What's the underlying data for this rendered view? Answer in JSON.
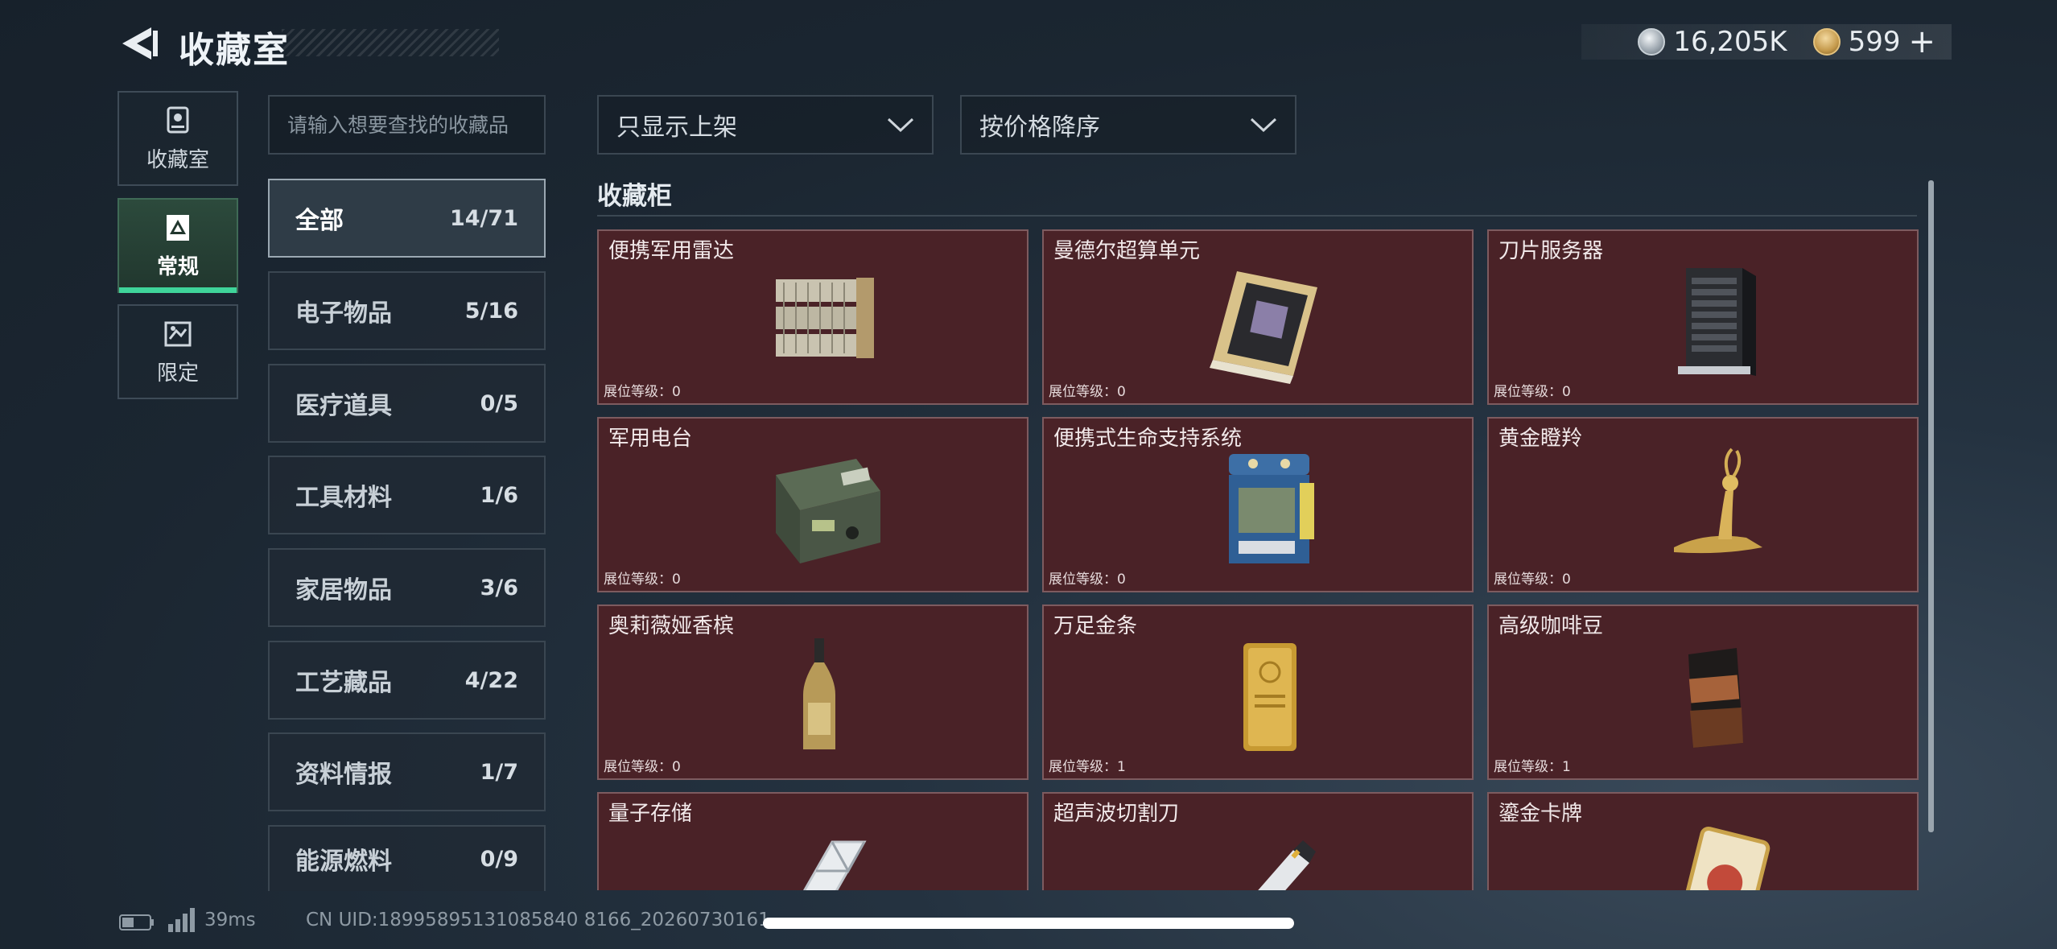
{
  "header": {
    "title": "收藏室",
    "currency": [
      {
        "icon": "silver-coin-icon",
        "value": "16,205K"
      },
      {
        "icon": "gold-gem-icon",
        "value": "599"
      }
    ],
    "plus": "+"
  },
  "nav": {
    "tabs": [
      {
        "label": "收藏室",
        "icon": "collection-room-icon",
        "active": false
      },
      {
        "label": "常规",
        "icon": "regular-icon",
        "active": true
      },
      {
        "label": "限定",
        "icon": "limited-icon",
        "active": false
      }
    ]
  },
  "search": {
    "placeholder": "请输入想要查找的收藏品"
  },
  "categories": [
    {
      "label": "全部",
      "count": "14/71",
      "active": true
    },
    {
      "label": "电子物品",
      "count": "5/16"
    },
    {
      "label": "医疗道具",
      "count": "0/5"
    },
    {
      "label": "工具材料",
      "count": "1/6"
    },
    {
      "label": "家居物品",
      "count": "3/6"
    },
    {
      "label": "工艺藏品",
      "count": "4/22"
    },
    {
      "label": "资料情报",
      "count": "1/7"
    },
    {
      "label": "能源燃料",
      "count": "0/9"
    }
  ],
  "filters": {
    "filter_label": "只显示上架",
    "sort_label": "按价格降序"
  },
  "section": {
    "title": "收藏柜"
  },
  "items": [
    {
      "name": "便携军用雷达",
      "level": "展位等级：0",
      "icon": "radar-icon"
    },
    {
      "name": "曼德尔超算单元",
      "level": "展位等级：0",
      "icon": "supercomputer-unit-icon"
    },
    {
      "name": "刀片服务器",
      "level": "展位等级：0",
      "icon": "blade-server-icon"
    },
    {
      "name": "军用电台",
      "level": "展位等级：0",
      "icon": "military-radio-icon"
    },
    {
      "name": "便携式生命支持系统",
      "level": "展位等级：0",
      "icon": "life-support-icon"
    },
    {
      "name": "黄金瞪羚",
      "level": "展位等级：0",
      "icon": "golden-gazelle-icon"
    },
    {
      "name": "奥莉薇娅香槟",
      "level": "展位等级：0",
      "icon": "champagne-icon"
    },
    {
      "name": "万足金条",
      "level": "展位等级：1",
      "icon": "gold-bar-icon"
    },
    {
      "name": "高级咖啡豆",
      "level": "展位等级：1",
      "icon": "coffee-beans-icon"
    },
    {
      "name": "量子存储",
      "level": "",
      "icon": "quantum-storage-icon"
    },
    {
      "name": "超声波切割刀",
      "level": "",
      "icon": "ultrasonic-cutter-icon"
    },
    {
      "name": "鎏金卡牌",
      "level": "",
      "icon": "gilded-card-icon"
    }
  ],
  "footer": {
    "ping": "39ms",
    "uid": "CN UID:18995895131085840 8166_20260730161"
  },
  "colors": {
    "accent": "#3fd49a",
    "card_bg": "#4a2227",
    "card_border": "#7d5b5f"
  }
}
